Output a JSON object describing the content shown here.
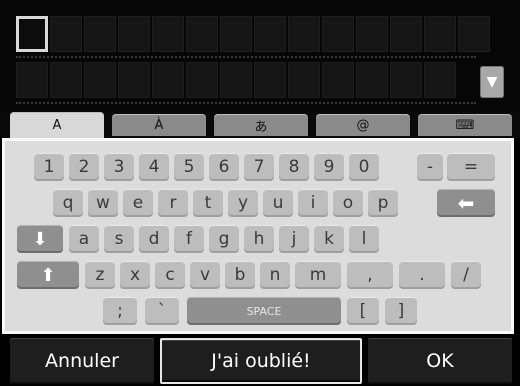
{
  "entry": {
    "cursor_icon": "text-cursor-box",
    "scroll_icon": "down-triangle-icon",
    "scroll_glyph": "▼"
  },
  "tabs": [
    {
      "label": "A",
      "active": true
    },
    {
      "label": "À",
      "active": false
    },
    {
      "label": "あ",
      "active": false
    },
    {
      "label": "@",
      "active": false
    },
    {
      "label": "⌨",
      "active": false
    }
  ],
  "keyboard": {
    "row1": [
      "1",
      "2",
      "3",
      "4",
      "5",
      "6",
      "7",
      "8",
      "9",
      "0",
      "-",
      "="
    ],
    "row2": [
      "q",
      "w",
      "e",
      "r",
      "t",
      "y",
      "u",
      "i",
      "o",
      "p"
    ],
    "backspace_glyph": "⬅",
    "backspace_icon": "backspace-arrow-icon",
    "caps_glyph": "⬇",
    "caps_icon": "caps-lock-down-arrow-icon",
    "row3": [
      "a",
      "s",
      "d",
      "f",
      "g",
      "h",
      "j",
      "k",
      "l"
    ],
    "shift_glyph": "⬆",
    "shift_icon": "shift-up-arrow-icon",
    "row4": [
      "z",
      "x",
      "c",
      "v",
      "b",
      "n",
      "m",
      ",",
      ".",
      "/"
    ],
    "row5_left": [
      ";",
      "`"
    ],
    "space_label": "SPACE",
    "row5_right": [
      "[",
      "]"
    ]
  },
  "buttons": {
    "cancel": "Annuler",
    "forgot": "J'ai oublié!",
    "ok": "OK"
  }
}
